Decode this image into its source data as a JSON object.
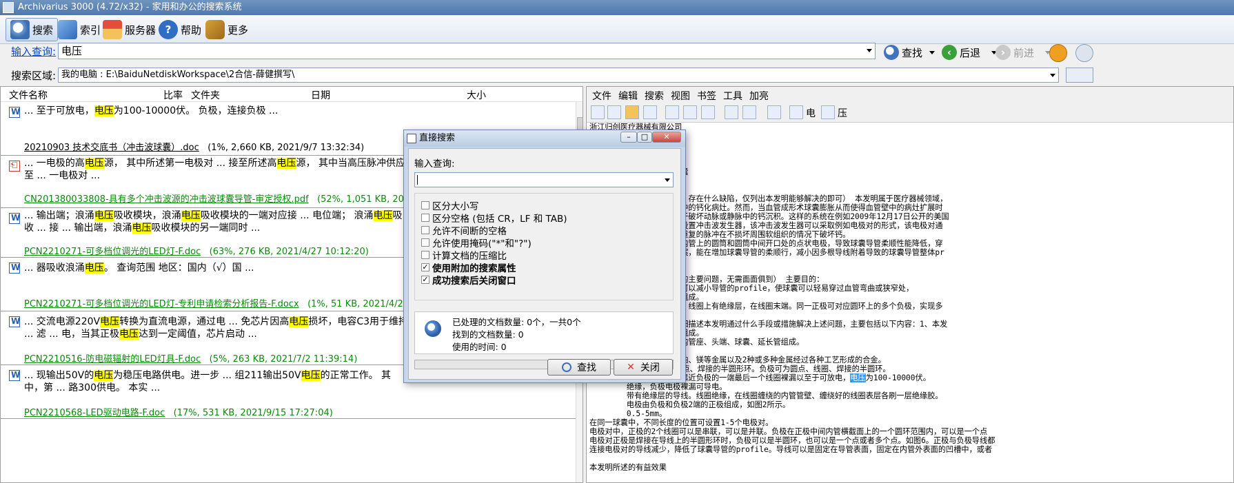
{
  "window": {
    "title": "Archivarius 3000 (4.72/x32) - 家用和办公的搜索系统"
  },
  "toolbar": {
    "search": "搜索",
    "index": "索引",
    "server": "服务器",
    "help": "帮助",
    "more": "更多"
  },
  "query": {
    "label": "输入查询:",
    "value": "电压",
    "search_button": "查找",
    "back_button": "后退",
    "forward_button": "前进"
  },
  "scope": {
    "label": "搜索区域:",
    "value": "我的电脑 : E:\\BaiduNetdiskWorkspace\\2合信-薛健撰写\\"
  },
  "results": {
    "columns": {
      "name": "文件名称",
      "ratio": "比率",
      "folder": "文件夹",
      "date": "日期",
      "size": "大小"
    },
    "items": [
      {
        "snippet_a": "... 至于可放电，",
        "hl1": "电压",
        "snippet_b": "为100-10000伏。 负极，连接负极 ...",
        "file": "20210903 技术交底书（冲击波球囊）.doc",
        "meta": "(1%, 2,660 KB, 2021/9/7 13:32:34)"
      },
      {
        "snippet_a": "... 一电极的高",
        "hl1": "电压",
        "snippet_b": "源， 其中所述第一电极对 ... 接至所述高",
        "hl2": "电压",
        "snippet_c": "源， 其中当高压脉冲供应至 ... 一电极对 ...",
        "file": "CN201380033808-具有多个冲击波源的冲击波球囊导管-审定授权.pdf",
        "meta": "(52%, 1,051 KB, 2021/9/8"
      },
      {
        "snippet_a": "... 输出端；浪涌",
        "hl1": "电压",
        "snippet_b": "吸收模块，浪涌",
        "hl2": "电压",
        "snippet_c": "吸收模块的一端对应接 ... 电位端； 浪涌",
        "hl3": "电压",
        "snippet_d": "吸收 ... 接 ... 输出端，浪涌",
        "hl4": "电压",
        "snippet_e": "吸收模块的另一端同时 ...",
        "file": "PCN2210271-可多档位调光的LED灯-F.doc",
        "meta": "(63%, 276 KB, 2021/4/27 10:12:20)"
      },
      {
        "snippet_a": "... 器吸收浪涌",
        "hl1": "电压",
        "snippet_b": "。 查询范围 地区：国内（√）国 ...",
        "file": "PCN2210271-可多档位调光的LED灯-专利申请检索分析报告-F.docx",
        "meta": "(1%, 51 KB, 2021/4/20 15:51"
      },
      {
        "snippet_a": "... 交流电源220V",
        "hl1": "电压",
        "snippet_b": "转换为直流电源，通过电 ... 免芯片因高",
        "hl2": "电压",
        "snippet_c": "损坏，电容C3用于维持 ... 滤 ... 电，当其正极",
        "hl3": "电压",
        "snippet_d": "达到一定阈值，芯片启动 ...",
        "file": "PCN2210516-防电磁辐射的LED灯具-F.doc",
        "meta": "(5%, 263 KB, 2021/7/2 11:39:14)"
      },
      {
        "snippet_a": "... 现输出50V的",
        "hl1": "电压",
        "snippet_b": "为稳压电路供电。进一步 ... 组211输出50V",
        "hl2": "电压",
        "snippet_c": "的正常工作。 其中，第 ... 路300供电。 本实 ...",
        "file": "PCN2210568-LED驱动电路-F.doc",
        "meta": "(17%, 531 KB, 2021/9/15 17:27:04)"
      }
    ]
  },
  "viewer": {
    "menu": [
      "文件",
      "编辑",
      "搜索",
      "视图",
      "书签",
      "工具",
      "加亮"
    ],
    "term1": "电",
    "term2": "压",
    "lines": [
      "浙江归创医疗器械有限公司",
      "",
      "",
      "        发明或实用新型）",
      "",
      "        准确）冲击波球囊",
      "",
      "",
      "        大体是怎么样的，存在什么缺陷，仅列出本发明能够解决的即可） 本发明属于医疗器械领域，",
      "        用于打开动脉壁中的钙化病灶。然而，当血管成形术球囊膨胀从而使得血管壁中的病灶扩展时",
      "        和方法已经被用于破坏动脉或静脉中的钙沉积。这样的系统在例如2009年12月17日公开的美国",
      "        膨胀。在气囊内设置冲击波发生器，该冲击波发生器可以采取例如电极对的形式，该电极对通",
      "        和钙化的区域。重复的脉冲在不损坏周围软组织的情况下破坏钙。",
      "        对使用的是套在内管上的圆筒和圆筒中间开口处的点状电极，导致球囊导管柔顺性能降低，穿",
      "        波球囊的设计方案，能在增加球囊导管的柔顺行，减小因多根导线附着导致的球囊导管整体pr",
      "",
      "",
      "        解决背景技术中的主要问题，无需面面俱到） 主要目的：",
      "        性能增高，同时可以减小导管的profile，使球囊可以轻易穿过血管弯曲或狭窄处，",
      "        冲击波发射装置组成。",
      "        采用线圈的形式，线圈上有绝缘层，在线圈末端。同一正极可对应圆环上的多个负极，实现多",
      "",
      "        ，并结合附图详细描述本发明通过什么手段或措施解决上述问题，主要包括以下内容：1、本发",
      "        冲击波发射装置组成。",
      "        内管、外管座、内管座、头端、球囊、延长管组成。",
      "        优选金属及合金。",
      "        、银、铜、铝、铂、镁等金属以及2种或多种金属经过各种工艺形成的合金。",
      "        20圈的线圈、圆点、焊接的半圆形环。负极可为圆点、线圈、焊接的半圆环。",
      "        的有绝缘层，在靠近负极的一端最后一个线圈裸漏以至于可放电，",
      "        绝缘，负极电极裸漏可导电。",
      "        带有绝缘层的导线。线圈绝缘，在线圈缠绕的内管管壁、缠绕好的线圈表层各刷一层绝缘胶。",
      "        电极由负极和负极2端的正极组成，如图2所示。",
      "        0.5-5mm。",
      "在同一球囊中，不同长度的位置可设置1-5个电极对。",
      "电极对中，正极的2个线圈可以是串联，可以是并联。负极在正极中间内管横截面上的一个圆环范围内，可以是一个点",
      "电极对正极是焊接在导线上的半圆形环时，负极可以是半圆环，也可以是一个点或者多个点。如图6。正极与负极导线都",
      "连接电极对的导线减少，降低了球囊导管的profile。导线可以是固定在导管表面，固定在内管外表面的凹槽中，或者",
      "",
      "本发明所述的有益效果"
    ],
    "sel_text": "电压",
    "sel_after": "为100-10000伏。"
  },
  "dialog": {
    "title": "直接搜索",
    "prompt": "输入查询:",
    "input_value": "",
    "options": [
      {
        "label": "区分大小写",
        "checked": false
      },
      {
        "label": "区分空格 (包括 CR，LF 和 TAB)",
        "checked": false
      },
      {
        "label": "允许不间断的空格",
        "checked": false
      },
      {
        "label": "允许使用掩码(\"*\"和\"?\")",
        "checked": false
      },
      {
        "label": "计算文档的压缩比",
        "checked": false
      },
      {
        "label": "使用附加的搜索属性",
        "checked": true
      },
      {
        "label": "成功搜索后关闭窗口",
        "checked": true
      }
    ],
    "status_processed": "已处理的文档数量: 0个，一共0个",
    "status_found": "找到的文档数量: 0",
    "status_time": "使用的时间: 0",
    "find_button": "查找",
    "close_button": "关闭"
  }
}
